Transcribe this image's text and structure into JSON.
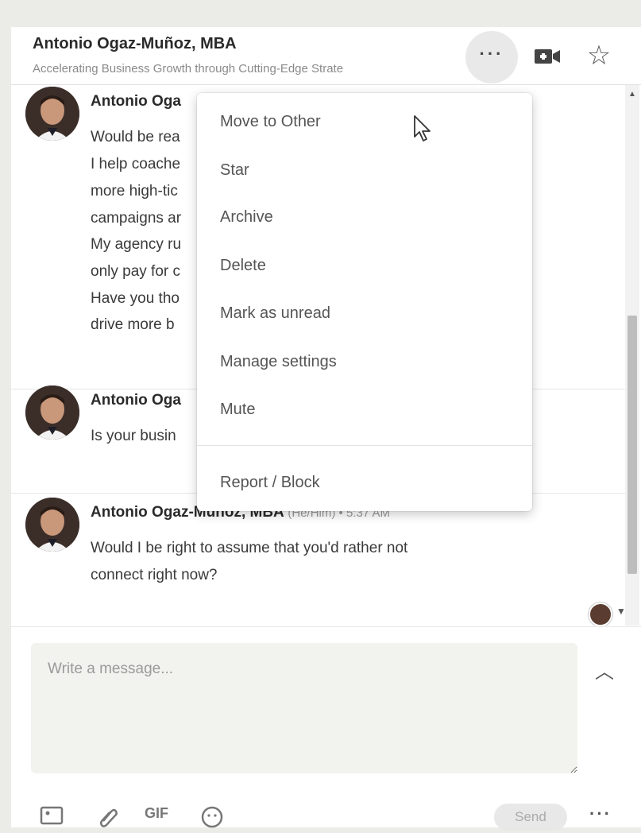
{
  "conversation": {
    "name": "Antonio Ogaz-Muñoz, MBA",
    "headline": "Accelerating Business Growth through Cutting-Edge Strate",
    "more_icon": "ellipsis-icon",
    "video_icon": "video-camera-icon",
    "star_icon": "star-icon"
  },
  "messages": [
    {
      "sender": "Antonio Oga",
      "lines": [
        "Would be rea",
        "I help coache",
        "more high-tic",
        "campaigns ar",
        "My agency ru",
        "only pay for c",
        "Have you tho",
        "drive more b"
      ]
    },
    {
      "sender": "Antonio Oga",
      "lines": [
        "Is your busin"
      ]
    },
    {
      "sender": "Antonio Ogaz-Muñoz, MBA",
      "meta": "(He/Him) • 5:37 AM",
      "lines": [
        "Would I be right to assume that you'd rather not",
        "connect right now?"
      ]
    }
  ],
  "menu": {
    "items": [
      "Move to Other",
      "Star",
      "Archive",
      "Delete",
      "Mark as unread",
      "Manage settings",
      "Mute",
      "Report / Block"
    ]
  },
  "composer": {
    "placeholder": "Write a message...",
    "value": "",
    "send_label": "Send",
    "gif_label": "GIF",
    "toolbar_icons": [
      "image-icon",
      "paperclip-icon",
      "gif-icon",
      "emoji-icon",
      "ellipsis-icon"
    ]
  },
  "colors": {
    "panel_bg": "#ffffff",
    "page_bg": "#ebebe8",
    "compose_bg": "#f2f2ef"
  }
}
